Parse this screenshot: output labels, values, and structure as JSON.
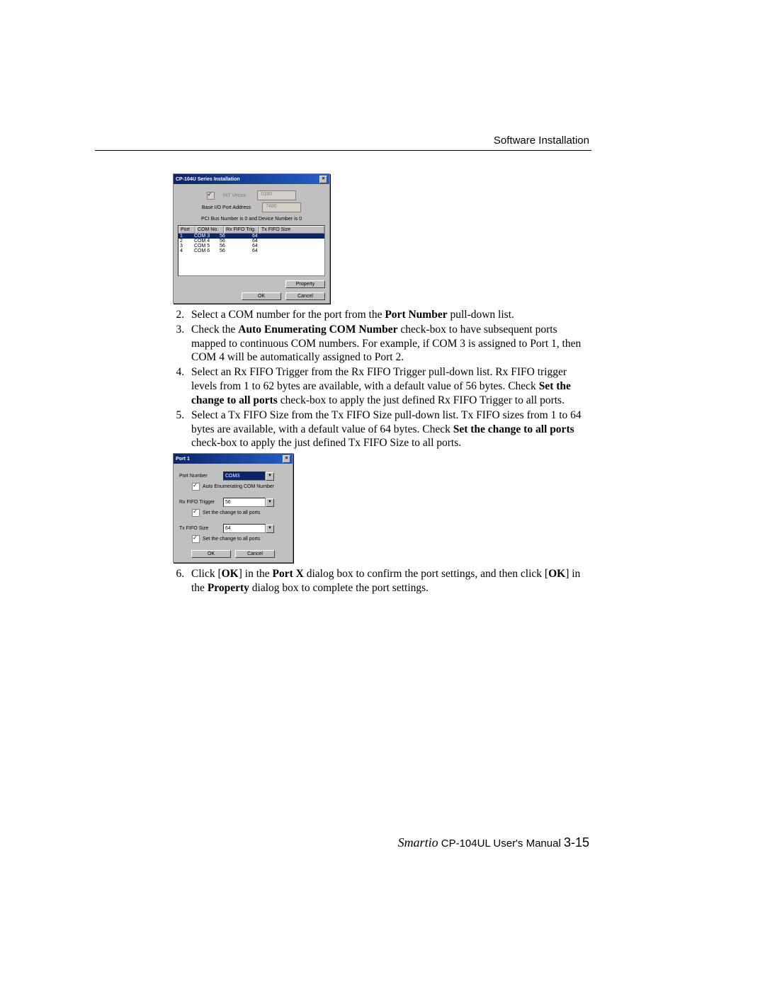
{
  "header": "Software Installation",
  "footer": {
    "brand": "Smartio",
    "product": " CP-104UL User's Manual ",
    "page": "3-15"
  },
  "dlg1": {
    "title": "CP-104U Series Installation",
    "int_vector_label": "INT Vector",
    "int_vector_value": "0180",
    "base_io_label": "Base I/O Port Address",
    "base_io_value": "7480",
    "pci_bus_text": "PCI Bus Number is 0 and Device Number is 0",
    "cols": {
      "c1": "Port",
      "c2": "COM No.",
      "c3": "Rx FIFO Trig.",
      "c4": "Tx FIFO Size"
    },
    "rows": [
      {
        "port": "1",
        "com": "COM 3",
        "rx": "56",
        "tx": "64",
        "selected": true
      },
      {
        "port": "2",
        "com": "COM 4",
        "rx": "56",
        "tx": "64",
        "selected": false
      },
      {
        "port": "3",
        "com": "COM 5",
        "rx": "56",
        "tx": "64",
        "selected": false
      },
      {
        "port": "4",
        "com": "COM 6",
        "rx": "56",
        "tx": "64",
        "selected": false
      }
    ],
    "property_btn": "Property",
    "ok_btn": "OK",
    "cancel_btn": "Cancel"
  },
  "dlg2": {
    "title": "Port 1",
    "port_number_label": "Port Number",
    "port_number_value": "COM3",
    "auto_enum_label": "Auto Enumerating COM Number",
    "rx_label": "Rx FIFO Trigger",
    "rx_value": "56",
    "rx_check_label": "Set the change to all ports",
    "tx_label": "Tx FIFO Size",
    "tx_value": "64",
    "tx_check_label": "Set the change to all ports",
    "ok_btn": "OK",
    "cancel_btn": "Cancel"
  },
  "steps": {
    "s2_a": "Select a COM number for the port from the ",
    "s2_b": "Port Number",
    "s2_c": " pull-down list.",
    "s3_a": "Check the ",
    "s3_b": "Auto Enumerating COM Number",
    "s3_c": " check-box to have subsequent ports mapped to continuous COM numbers. For example, if COM 3 is assigned to Port 1, then COM 4 will be automatically assigned to Port 2.",
    "s4_a": "Select an Rx FIFO Trigger from the Rx FIFO Trigger pull-down list. Rx FIFO trigger levels from 1 to 62 bytes are available, with a default value of 56 bytes. Check ",
    "s4_b": "Set the change to all ports",
    "s4_c": " check-box to apply the just defined Rx FIFO Trigger to all ports.",
    "s5_a": "Select a Tx FIFO Size from the Tx FIFO Size pull-down list. Tx FIFO sizes from 1 to 64 bytes are available, with a default value of 64 bytes. Check ",
    "s5_b": "Set the change to all ports",
    "s5_c": " check-box to apply the just defined Tx FIFO Size to all ports.",
    "s6_a": "Click [",
    "s6_b": "OK",
    "s6_c": "] in the ",
    "s6_d": "Port X",
    "s6_e": " dialog box to confirm the port settings, and then click [",
    "s6_f": "OK",
    "s6_g": "] in the ",
    "s6_h": "Property",
    "s6_i": " dialog box to complete the port settings."
  }
}
